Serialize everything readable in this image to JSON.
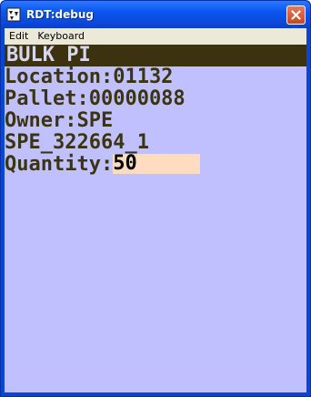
{
  "window": {
    "title": "RDT:debug",
    "app_icon": "rdt-app-icon",
    "close_icon": "close-icon"
  },
  "menu": {
    "items": [
      "Edit",
      "Keyboard"
    ]
  },
  "screen": {
    "header": "BULK PI",
    "location": "Location:01132",
    "pallet": "Pallet:00000088",
    "owner": "Owner:SPE",
    "reference": "SPE_322664_1",
    "quantity_label": "Quantity:",
    "quantity_value": "50"
  },
  "colors": {
    "background": "#c0c0ff",
    "header_bg": "#3c3210",
    "text": "#3a3510",
    "input_bg": "#ffdcc0"
  }
}
